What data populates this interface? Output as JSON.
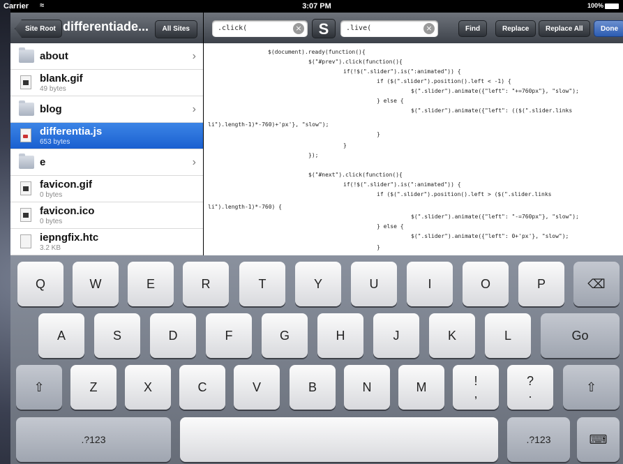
{
  "status_bar": {
    "carrier": "Carrier",
    "time": "3:07 PM",
    "battery": "100%"
  },
  "left_toolbar": {
    "back_label": "Site Root",
    "title": "differentiade...",
    "all_sites_label": "All Sites"
  },
  "right_toolbar": {
    "find_value": ".click(",
    "replace_value": ".live(",
    "separator_icon": "S",
    "find_label": "Find",
    "replace_label": "Replace",
    "replace_all_label": "Replace All",
    "done_label": "Done"
  },
  "files": [
    {
      "name": "about",
      "type": "folder"
    },
    {
      "name": "blank.gif",
      "size": "49 bytes",
      "type": "image"
    },
    {
      "name": "blog",
      "type": "folder"
    },
    {
      "name": "differentia.js",
      "size": "653 bytes",
      "type": "js",
      "selected": true
    },
    {
      "name": "e",
      "type": "folder"
    },
    {
      "name": "favicon.gif",
      "size": "0 bytes",
      "type": "image"
    },
    {
      "name": "favicon.ico",
      "size": "0 bytes",
      "type": "image"
    },
    {
      "name": "iepngfix.htc",
      "size": "3.2 KB",
      "type": "doc"
    }
  ],
  "code_lines": [
    "$(document).ready(function(){",
    "$(\"#prev\").click(function(){",
    "if(!$(\".slider\").is(\":animated\")) {",
    "if ($(\".slider\").position().left < -1) {",
    "$(\".slider\").animate({\"left\": \"+=760px\"}, \"slow\");",
    "} else {",
    "$(\".slider\").animate({\"left\": (($(\".slider.links",
    "li\").length-1)*-760)+'px'}, \"slow\");",
    "}",
    "}",
    "});",
    "$(\"#next\").click(function(){",
    "if(!$(\".slider\").is(\":animated\")) {",
    "if ($(\".slider\").position().left > ($(\".slider.links",
    "li\").length-1)*-760) {",
    "$(\".slider\").animate({\"left\": \"-=760px\"}, \"slow\");",
    "} else {",
    "$(\".slider\").animate({\"left\": 0+'px'}, \"slow\");",
    "}"
  ],
  "keyboard": {
    "row1": [
      "Q",
      "W",
      "E",
      "R",
      "T",
      "Y",
      "U",
      "I",
      "O",
      "P"
    ],
    "row2": [
      "A",
      "S",
      "D",
      "F",
      "G",
      "H",
      "J",
      "K",
      "L"
    ],
    "row3": [
      "Z",
      "X",
      "C",
      "V",
      "B",
      "N",
      "M"
    ],
    "go_label": "Go",
    "numbers_label": ".?123",
    "exclaim_top": "!",
    "exclaim_bottom": ",",
    "question_top": "?",
    "question_bottom": "."
  }
}
